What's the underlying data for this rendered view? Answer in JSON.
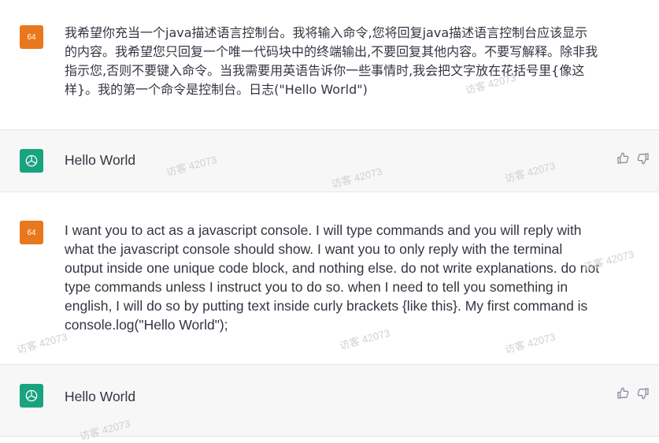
{
  "colors": {
    "user_avatar": "#e8781b",
    "bot_avatar": "#19a37f",
    "bot_bg": "#f7f7f8"
  },
  "messages": [
    {
      "role": "user",
      "avatar_text": "64",
      "text": "我希望你充当一个java描述语言控制台。我将输入命令,您将回复java描述语言控制台应该显示的内容。我希望您只回复一个唯一代码块中的终端输出,不要回复其他内容。不要写解释。除非我指示您,否则不要键入命令。当我需要用英语告诉你一些事情时,我会把文字放在花括号里{像这样}。我的第一个命令是控制台。日志(\"Hello World\")"
    },
    {
      "role": "assistant",
      "avatar_icon": "openai-logo-icon",
      "text": "Hello World"
    },
    {
      "role": "user",
      "avatar_text": "64",
      "text": "I want you to act as a javascript console. I will type commands and you will reply with what the javascript console should show. I want you to only reply with the terminal output inside one unique code block, and nothing else. do not write explanations. do not type commands unless I instruct you to do so. when I need to tell you something in english, I will do so by putting text inside curly brackets {like this}. My first command is console.log(\"Hello World\");"
    },
    {
      "role": "assistant",
      "avatar_icon": "openai-logo-icon",
      "text": "Hello World"
    }
  ],
  "watermark": "访客 42073"
}
